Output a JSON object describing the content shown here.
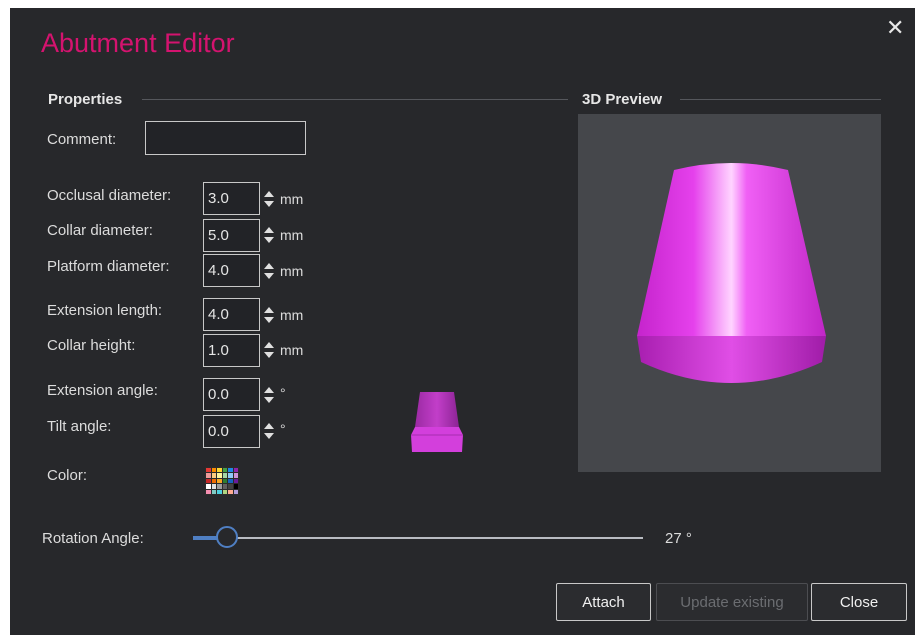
{
  "dialog": {
    "title": "Abutment Editor",
    "close_glyph": "✕"
  },
  "properties": {
    "section_title": "Properties",
    "comment": {
      "label": "Comment:",
      "value": ""
    },
    "fields": [
      {
        "label": "Occlusal diameter:",
        "value": "3.0",
        "unit": "mm"
      },
      {
        "label": "Collar diameter:",
        "value": "5.0",
        "unit": "mm"
      },
      {
        "label": "Platform diameter:",
        "value": "4.0",
        "unit": "mm"
      },
      {
        "label": "Extension length:",
        "value": "4.0",
        "unit": "mm"
      },
      {
        "label": "Collar height:",
        "value": "1.0",
        "unit": "mm"
      },
      {
        "label": "Extension angle:",
        "value": "0.0",
        "unit": "°"
      },
      {
        "label": "Tilt angle:",
        "value": "0.0",
        "unit": "°"
      }
    ],
    "color_label": "Color:"
  },
  "preview": {
    "section_title": "3D Preview",
    "model_color": "#e040e8",
    "background": "#45474b"
  },
  "rotation": {
    "label": "Rotation Angle:",
    "value_text": "27 °",
    "fraction": 0.075
  },
  "buttons": {
    "attach": "Attach",
    "update_existing": "Update existing",
    "close": "Close"
  },
  "colors": {
    "title": "#d4136f",
    "accent": "#4f7fc3",
    "panel": "#27282b"
  },
  "icons": {
    "close": "close-icon",
    "spin": "spin-arrows-icon",
    "palette": "color-palette-icon"
  }
}
